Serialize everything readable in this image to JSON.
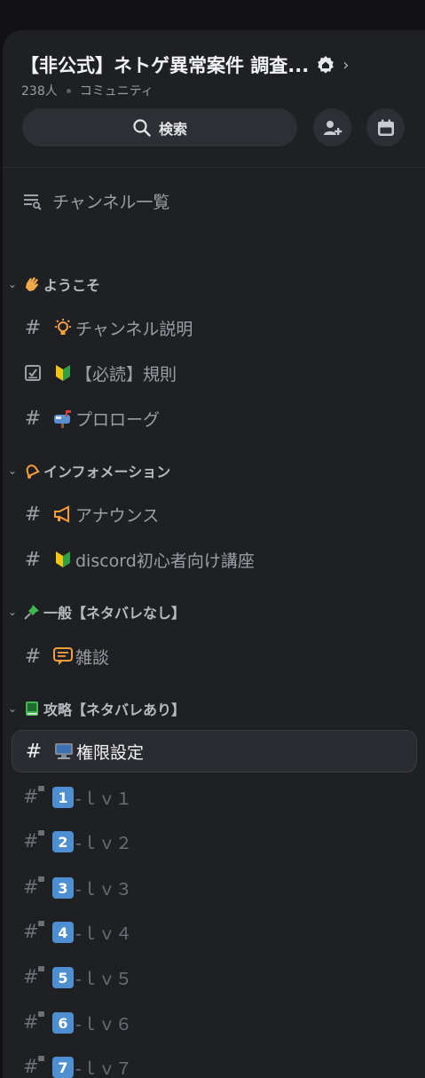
{
  "server": {
    "title": "【非公式】ネトゲ異常案件 調査...",
    "members": "238人",
    "type": "コミュニティ"
  },
  "search": {
    "label": "検索"
  },
  "browse": {
    "label": "チャンネル一覧"
  },
  "categories": [
    {
      "name": "ようこそ",
      "emoji": "waving-hand"
    },
    {
      "name": "インフォメーション",
      "emoji": "bell"
    },
    {
      "name": "一般【ネタバレなし】",
      "emoji": "pushpin"
    },
    {
      "name": "攻略【ネタバレあり】",
      "emoji": "green-book"
    }
  ],
  "channels": [
    {
      "label": "チャンネル説明",
      "emoji": "light-bulb",
      "type": "text"
    },
    {
      "label": "【必読】規則",
      "emoji": "beginner-mark",
      "type": "rules"
    },
    {
      "label": "プロローグ",
      "emoji": "mailbox",
      "type": "text"
    },
    {
      "label": "アナウンス",
      "emoji": "megaphone",
      "type": "text"
    },
    {
      "label": "discord初心者向け講座",
      "emoji": "beginner-mark",
      "type": "text"
    },
    {
      "label": "雑談",
      "emoji": "speech-balloon",
      "type": "text"
    },
    {
      "label": "権限設定",
      "emoji": "desktop-computer",
      "type": "text",
      "selected": true
    },
    {
      "label": "-ｌｖ１",
      "key": "1",
      "type": "locked"
    },
    {
      "label": "-ｌｖ２",
      "key": "2",
      "type": "locked"
    },
    {
      "label": "-ｌｖ３",
      "key": "3",
      "type": "locked"
    },
    {
      "label": "-ｌｖ４",
      "key": "4",
      "type": "locked"
    },
    {
      "label": "-ｌｖ５",
      "key": "5",
      "type": "locked"
    },
    {
      "label": "-ｌｖ６",
      "key": "6",
      "type": "locked"
    },
    {
      "label": "-ｌｖ７",
      "key": "7",
      "type": "locked"
    }
  ],
  "colors": {
    "background": "#1f2024",
    "selected": "#2b2c31",
    "accent": "#4d8fd1"
  }
}
